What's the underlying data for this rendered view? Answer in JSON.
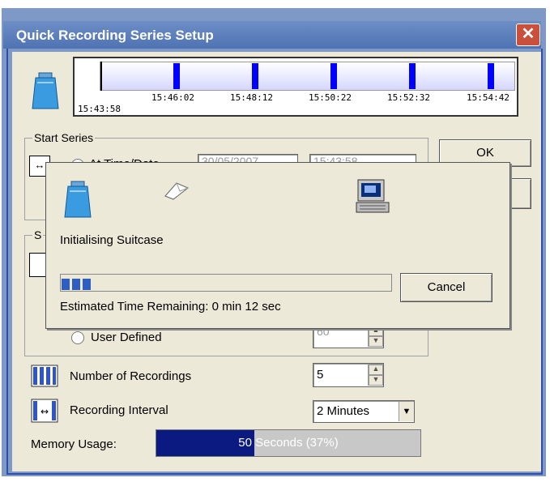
{
  "window": {
    "title": "Quick Recording Series Setup",
    "close_icon": "close-icon"
  },
  "timeline": {
    "start": "15:43:58",
    "ticks": [
      "15:46:02",
      "15:48:12",
      "15:50:22",
      "15:52:32",
      "15:54:42"
    ]
  },
  "start_series": {
    "legend": "Start Series",
    "option_label": "At Time/Date",
    "date_value": "30/05/2007",
    "time_value": "15:43:58"
  },
  "second_group": {
    "legend": "S"
  },
  "buttons": {
    "ok": "OK",
    "cancel": "Cancel"
  },
  "user_defined": {
    "label": "User Defined",
    "value": "60"
  },
  "number_of_recordings": {
    "label": "Number of Recordings",
    "value": "5"
  },
  "recording_interval": {
    "label": "Recording Interval",
    "value": "2 Minutes"
  },
  "memory_usage": {
    "label": "Memory Usage:",
    "text": "50 Seconds (37%)",
    "fraction": 0.37
  },
  "progress_dialog": {
    "status": "Initialising Suitcase",
    "eta": "Estimated Time Remaining: 0 min 12 sec",
    "cancel_label": "Cancel",
    "progress_fraction": 0.1
  },
  "colors": {
    "title_bar": "#4f72b3",
    "marker": "#0000ff",
    "memory_fill": "#0a1a80",
    "progress_fill": "#2e5fc0"
  }
}
